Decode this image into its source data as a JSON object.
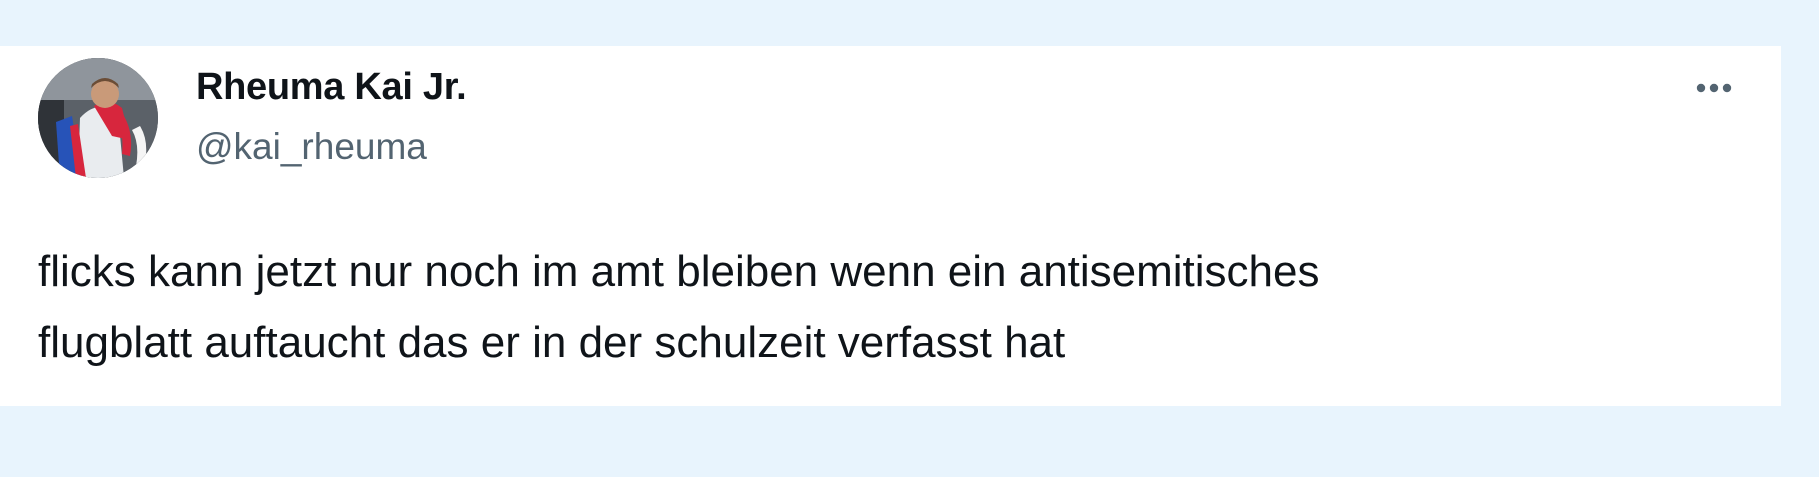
{
  "tweet": {
    "author_name": "Rheuma Kai Jr.",
    "author_handle": "@kai_rheuma",
    "avatar_icon": "user-avatar-photo",
    "more_icon": "more-options-icon",
    "text_lines": [
      "flicks kann jetzt nur noch im amt bleiben wenn ein antisemitisches",
      "flugblatt auftaucht das er in der schulzeit verfasst hat"
    ]
  },
  "colors": {
    "page_background": "#e8f4fd",
    "card_background": "#ffffff",
    "text_primary": "#0f1419",
    "text_secondary": "#536471"
  }
}
